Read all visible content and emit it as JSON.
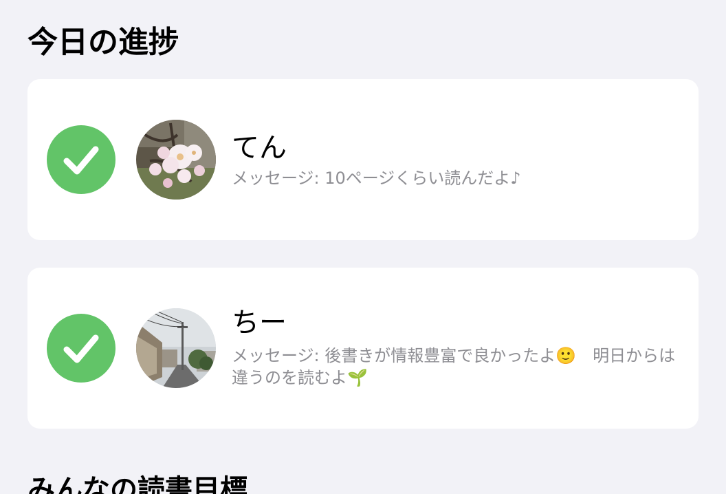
{
  "section": {
    "title": "今日の進捗"
  },
  "entries": [
    {
      "name": "てん",
      "message_label": "メッセージ: ",
      "message": "10ページくらい読んだよ♪",
      "status": "completed",
      "avatar": "cherry-blossom-photo"
    },
    {
      "name": "ちー",
      "message_label": "メッセージ: ",
      "message": "後書きが情報豊富で良かったよ🙂　明日からは違うのを読むよ🌱",
      "status": "completed",
      "avatar": "street-photo"
    }
  ],
  "next_section": {
    "title": "みんなの読書目標"
  },
  "colors": {
    "background": "#f2f2f7",
    "card": "#ffffff",
    "check": "#62c468",
    "secondary_text": "#8e8e93"
  },
  "icons": {
    "status": "checkmark-circle-icon"
  }
}
